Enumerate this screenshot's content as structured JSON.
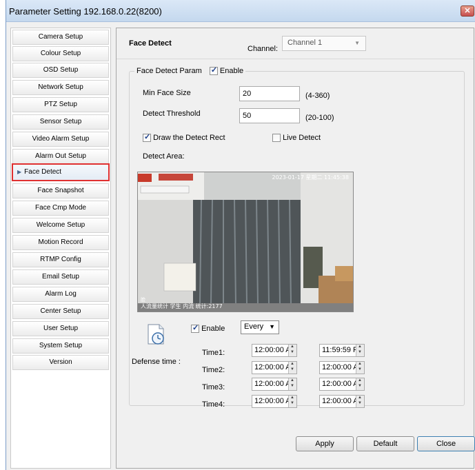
{
  "window": {
    "title": "Parameter Setting 192.168.0.22(8200)",
    "close_glyph": "✕"
  },
  "sidebar": {
    "items": [
      {
        "label": "Camera Setup"
      },
      {
        "label": "Colour Setup"
      },
      {
        "label": "OSD Setup"
      },
      {
        "label": "Network Setup"
      },
      {
        "label": "PTZ Setup"
      },
      {
        "label": "Sensor Setup"
      },
      {
        "label": "Video Alarm Setup"
      },
      {
        "label": "Alarm Out Setup"
      },
      {
        "label": "Face Detect",
        "active": true
      },
      {
        "label": "Face Snapshot"
      },
      {
        "label": "Face Cmp Mode"
      },
      {
        "label": "Welcome Setup"
      },
      {
        "label": "Motion Record"
      },
      {
        "label": "RTMP Config"
      },
      {
        "label": "Email Setup"
      },
      {
        "label": "Alarm Log"
      },
      {
        "label": "Center Setup"
      },
      {
        "label": "User Setup"
      },
      {
        "label": "System Setup"
      },
      {
        "label": "Version"
      }
    ]
  },
  "panel": {
    "title": "Face Detect",
    "channel_label": "Channel:",
    "channel_value": "Channel 1",
    "group_legend": "Face Detect Param",
    "enable_label": "Enable",
    "min_face_size_label": "Min Face Size",
    "min_face_size_value": "20",
    "min_face_size_range": "(4-360)",
    "detect_threshold_label": "Detect Threshold",
    "detect_threshold_value": "50",
    "detect_threshold_range": "(20-100)",
    "draw_rect_label": "Draw the Detect Rect",
    "live_detect_label": "Live Detect",
    "detect_area_label": "Detect Area:",
    "video_timestamp": "2023-01-17 星期二 11:45:38",
    "video_caption": "人流量统计 学生 内流 统计:2177",
    "video_small_text": "脸",
    "defense": {
      "label": "Defense time :",
      "enable_label": "Enable",
      "mode": "Every",
      "rows": [
        {
          "label": "Time1:",
          "start": "12:00:00 A",
          "end": "11:59:59 F"
        },
        {
          "label": "Time2:",
          "start": "12:00:00 A",
          "end": "12:00:00 A"
        },
        {
          "label": "Time3:",
          "start": "12:00:00 A",
          "end": "12:00:00 A"
        },
        {
          "label": "Time4:",
          "start": "12:00:00 A",
          "end": "12:00:00 A"
        }
      ]
    }
  },
  "buttons": {
    "apply": "Apply",
    "default": "Default",
    "close": "Close"
  },
  "colors": {
    "highlight": "#e03030",
    "title_gradient": "#c4d8ee"
  }
}
